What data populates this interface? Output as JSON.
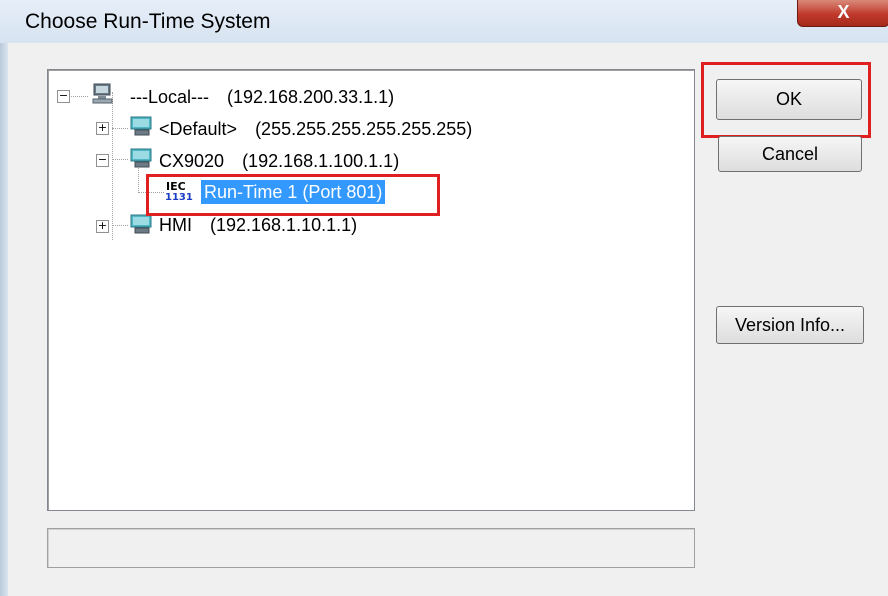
{
  "window": {
    "title": "Choose Run-Time System",
    "close_glyph": "X"
  },
  "tree": {
    "nodes": [
      {
        "name": "---Local---",
        "address": "(192.168.200.33.1.1)",
        "expander": "−"
      },
      {
        "name": "<Default>",
        "address": "(255.255.255.255.255.255)",
        "expander": "+"
      },
      {
        "name": "CX9020",
        "address": "(192.168.1.100.1.1)",
        "expander": "−"
      },
      {
        "name": "Run-Time 1 (Port 801)",
        "icon_text_top": "IEC",
        "icon_text_bottom": "1131",
        "selected": true
      },
      {
        "name": "HMI",
        "address": "(192.168.1.10.1.1)",
        "expander": "+"
      }
    ]
  },
  "buttons": {
    "ok": "OK",
    "cancel": "Cancel",
    "version_info": "Version Info..."
  },
  "colors": {
    "highlight": "#e02020",
    "selection": "#3399ff"
  }
}
